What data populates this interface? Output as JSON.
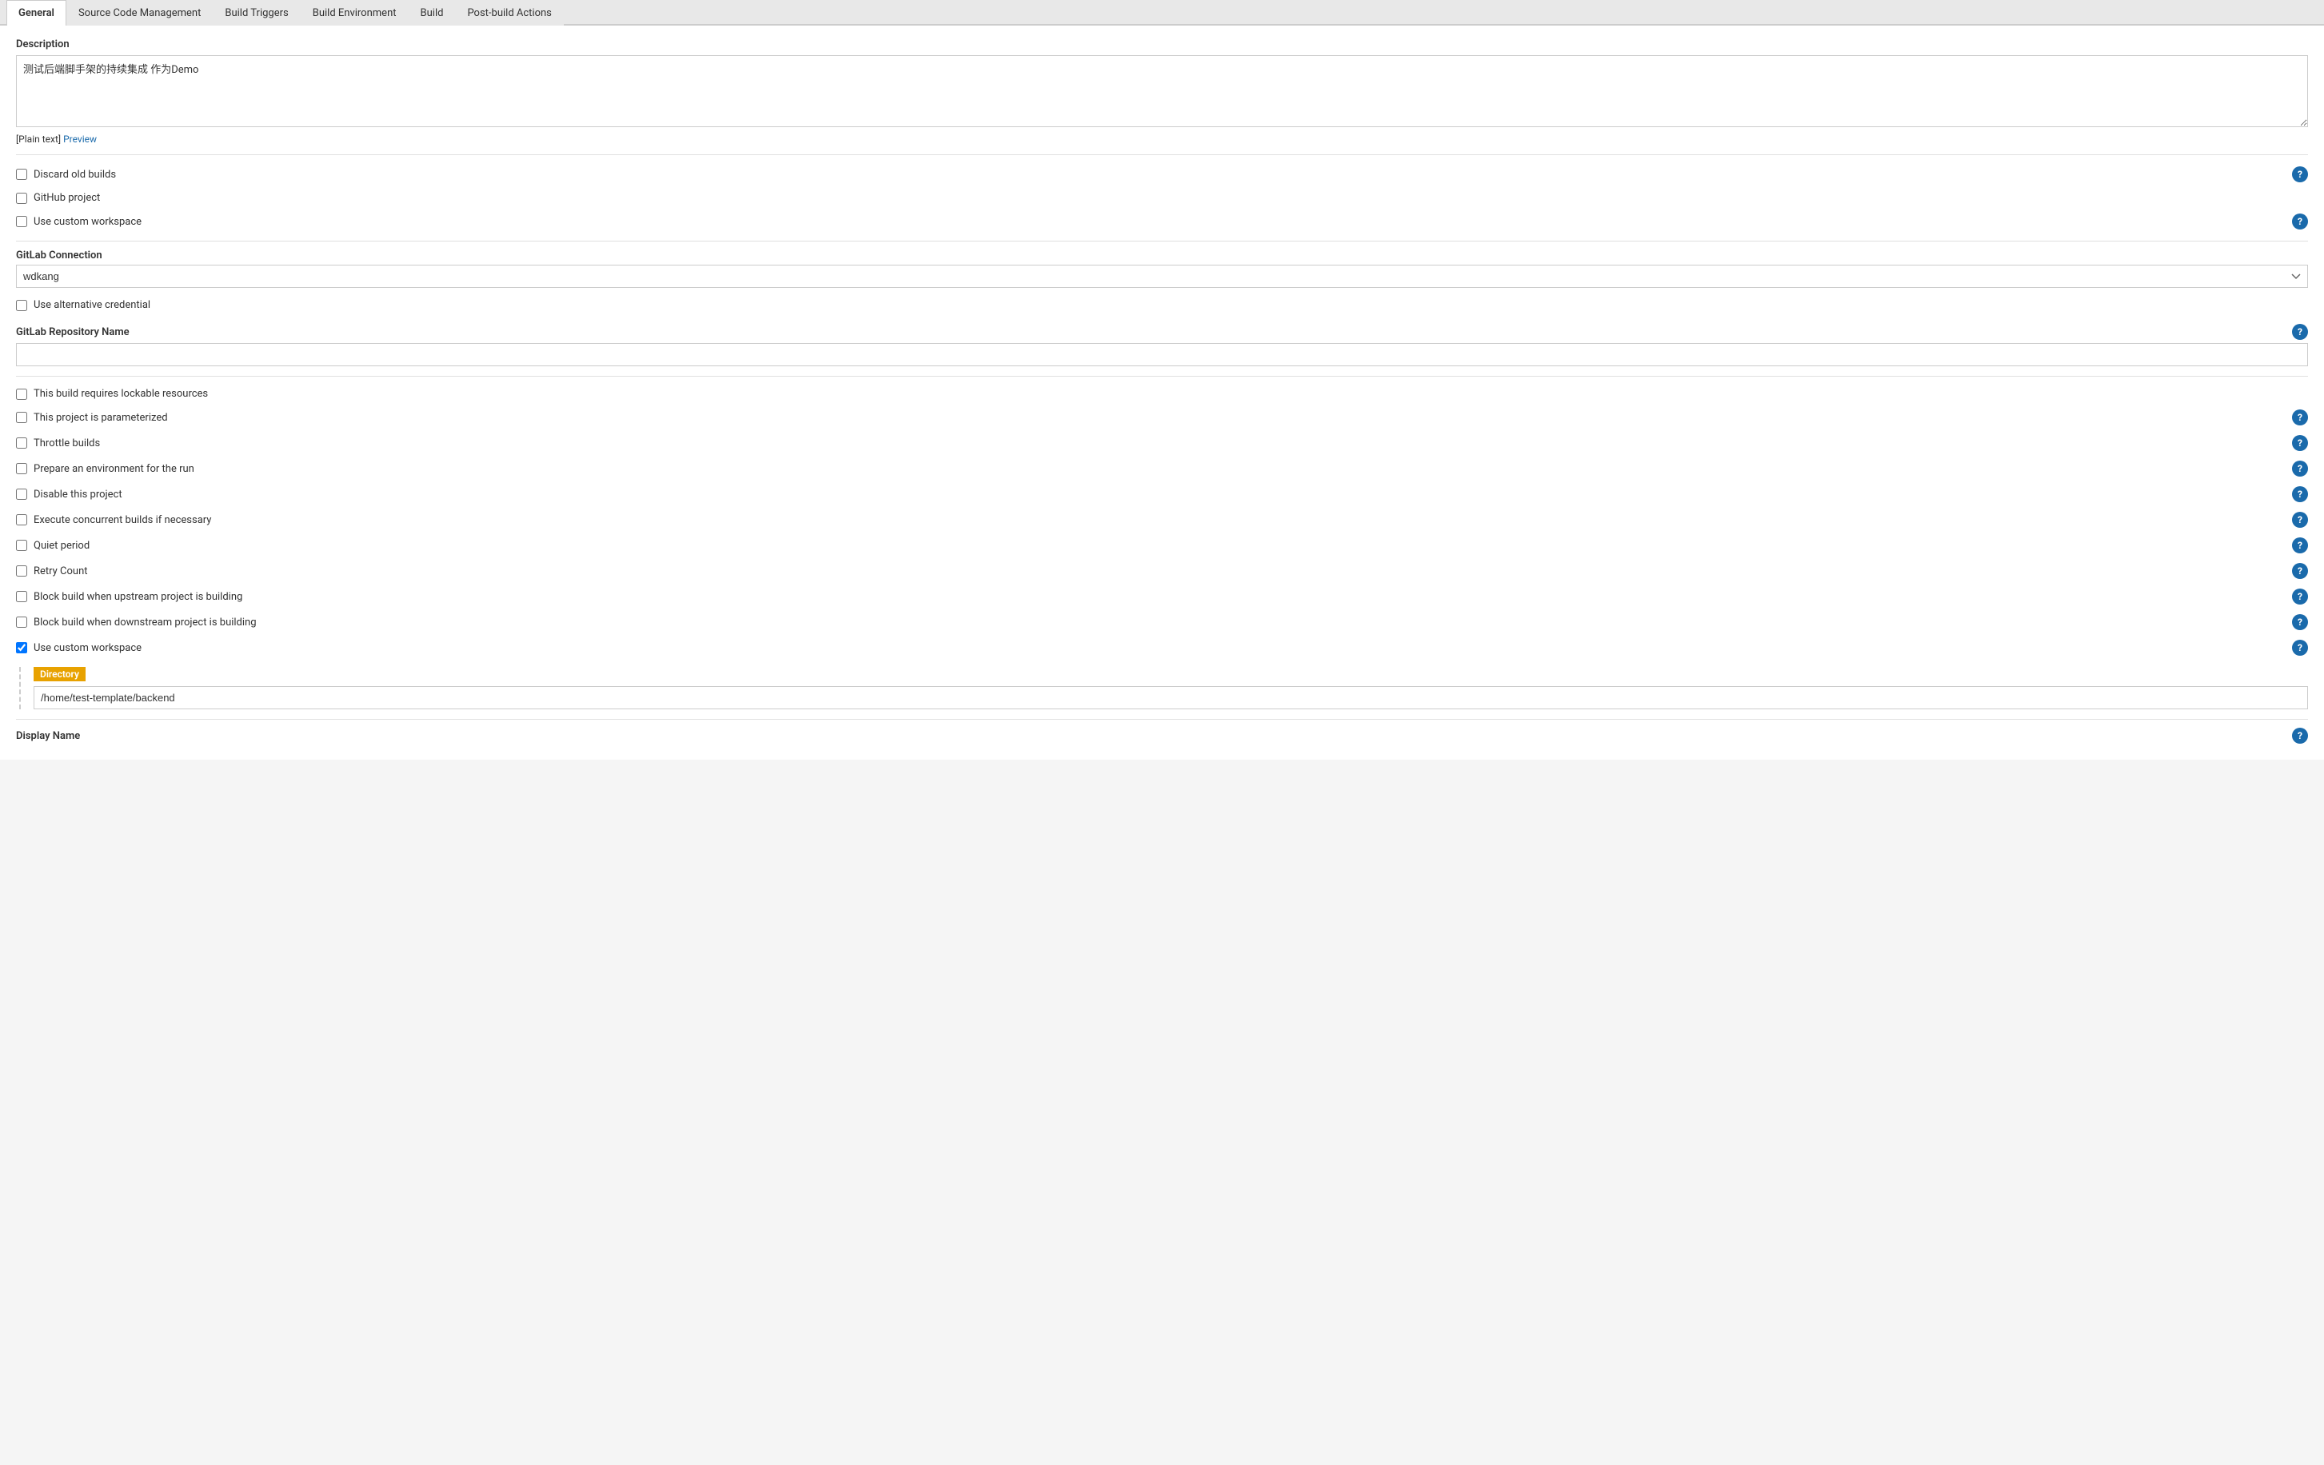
{
  "tabs": [
    {
      "label": "General",
      "active": true
    },
    {
      "label": "Source Code Management",
      "active": false
    },
    {
      "label": "Build Triggers",
      "active": false
    },
    {
      "label": "Build Environment",
      "active": false
    },
    {
      "label": "Build",
      "active": false
    },
    {
      "label": "Post-build Actions",
      "active": false
    }
  ],
  "description": {
    "label": "Description",
    "value": "测试后端脚手架的持续集成 作为Demo",
    "format_plain": "[Plain text]",
    "format_preview": "Preview"
  },
  "checkboxes_top": [
    {
      "id": "cb1",
      "label": "Discard old builds",
      "checked": false,
      "hasHelp": true
    },
    {
      "id": "cb2",
      "label": "GitHub project",
      "checked": false,
      "hasHelp": false
    },
    {
      "id": "cb3",
      "label": "Use custom workspace",
      "checked": false,
      "hasHelp": true
    }
  ],
  "gitlab_connection": {
    "label": "GitLab Connection",
    "value": "wdkang",
    "options": [
      "wdkang"
    ]
  },
  "alternative_credential": {
    "label": "Use alternative credential",
    "checked": false
  },
  "gitlab_repo": {
    "label": "GitLab Repository Name",
    "value": "",
    "hasHelp": true
  },
  "checkboxes_bottom": [
    {
      "id": "cb_lockable",
      "label": "This build requires lockable resources",
      "checked": false,
      "hasHelp": false
    },
    {
      "id": "cb_parameterized",
      "label": "This project is parameterized",
      "checked": false,
      "hasHelp": true
    },
    {
      "id": "cb_throttle",
      "label": "Throttle builds",
      "checked": false,
      "hasHelp": true
    },
    {
      "id": "cb_env",
      "label": "Prepare an environment for the run",
      "checked": false,
      "hasHelp": true
    },
    {
      "id": "cb_disable",
      "label": "Disable this project",
      "checked": false,
      "hasHelp": true
    },
    {
      "id": "cb_concurrent",
      "label": "Execute concurrent builds if necessary",
      "checked": false,
      "hasHelp": true
    },
    {
      "id": "cb_quiet",
      "label": "Quiet period",
      "checked": false,
      "hasHelp": true
    },
    {
      "id": "cb_retry",
      "label": "Retry Count",
      "checked": false,
      "hasHelp": true
    },
    {
      "id": "cb_block_upstream",
      "label": "Block build when upstream project is building",
      "checked": false,
      "hasHelp": true
    },
    {
      "id": "cb_block_downstream",
      "label": "Block build when downstream project is building",
      "checked": false,
      "hasHelp": true
    },
    {
      "id": "cb_custom_ws",
      "label": "Use custom workspace",
      "checked": true,
      "hasHelp": true
    }
  ],
  "workspace": {
    "directory_label": "Directory",
    "directory_value": "/home/test-template/backend"
  },
  "display_name": {
    "label": "Display Name",
    "hasHelp": true
  },
  "help_icon_symbol": "?"
}
